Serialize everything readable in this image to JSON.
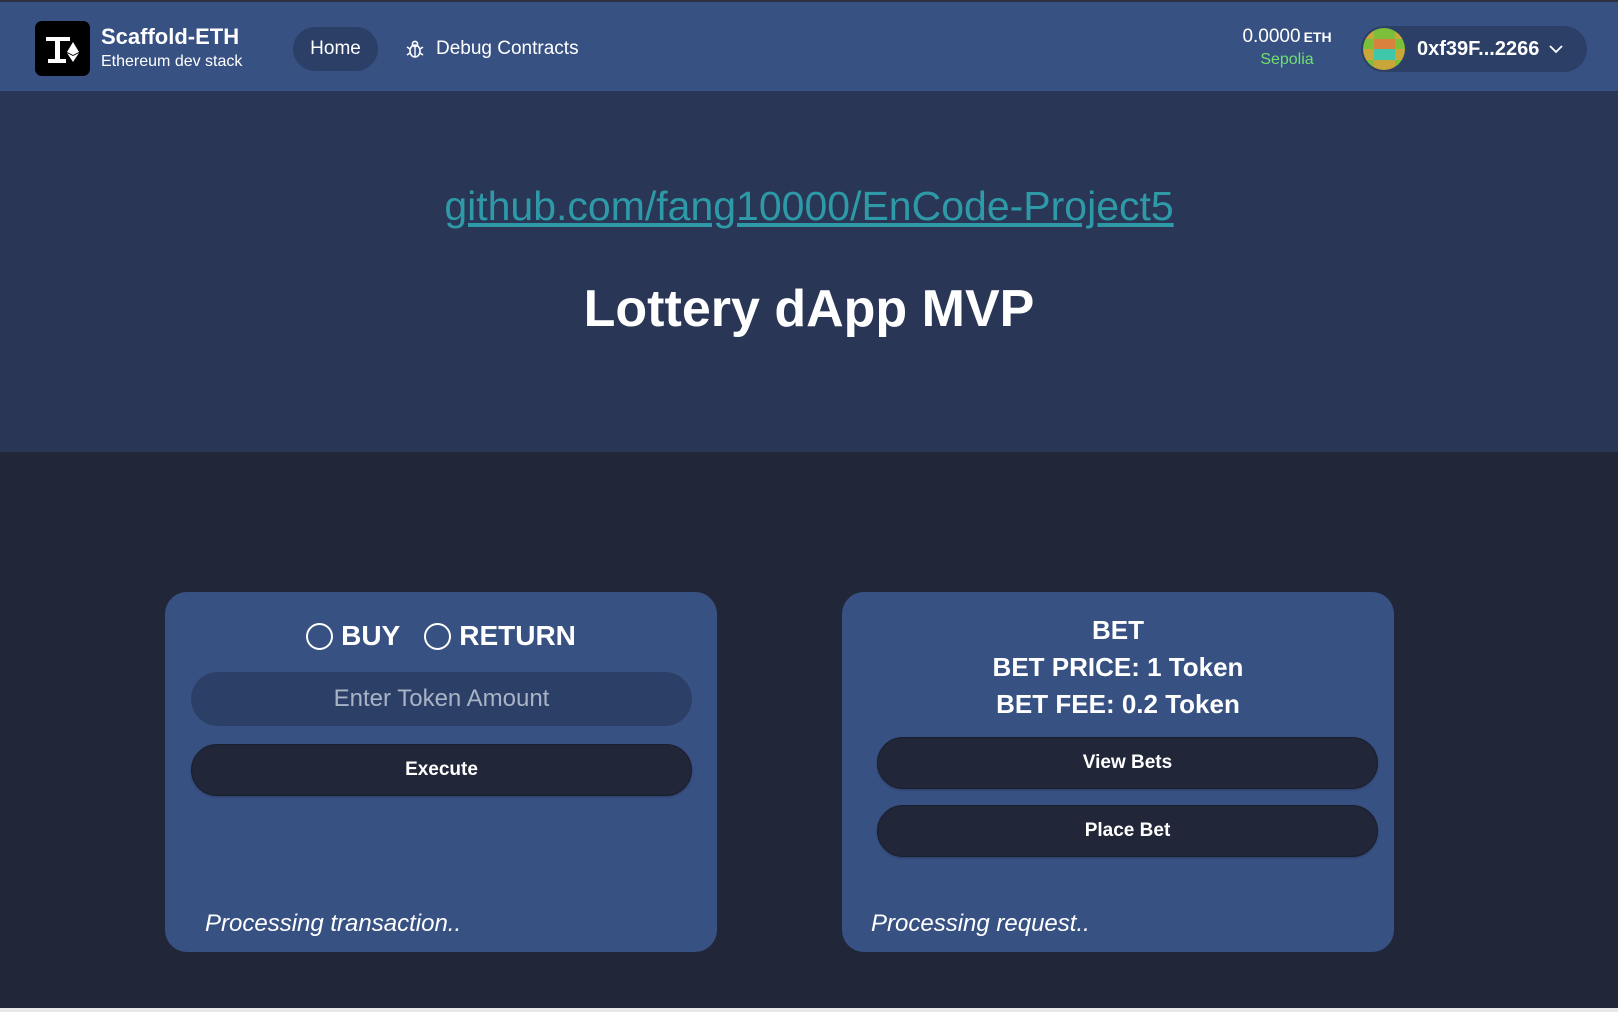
{
  "header": {
    "brand_title": "Scaffold-ETH",
    "brand_subtitle": "Ethereum dev stack",
    "nav": {
      "home_label": "Home",
      "debug_label": "Debug Contracts"
    },
    "balance": {
      "value": "0.0000",
      "unit": "ETH",
      "network": "Sepolia"
    },
    "account": {
      "address": "0xf39F...2266"
    }
  },
  "hero": {
    "link_text": "github.com/fang10000/EnCode-Project5",
    "title": "Lottery dApp MVP"
  },
  "token_card": {
    "options": [
      "BUY",
      "RETURN"
    ],
    "input_placeholder": "Enter Token Amount",
    "execute_label": "Execute",
    "status": "Processing transaction.."
  },
  "bet_card": {
    "heading": "BET",
    "price_line": "BET PRICE: 1 Token",
    "fee_line": "BET FEE: 0.2 Token",
    "view_label": "View Bets",
    "place_label": "Place Bet",
    "status": "Processing request.."
  },
  "colors": {
    "header_bg": "#385183",
    "hero_bg": "#2a3655",
    "page_bg": "#212638",
    "card_bg": "#385183",
    "link": "#2e9aa8",
    "network": "#6ee06e"
  }
}
